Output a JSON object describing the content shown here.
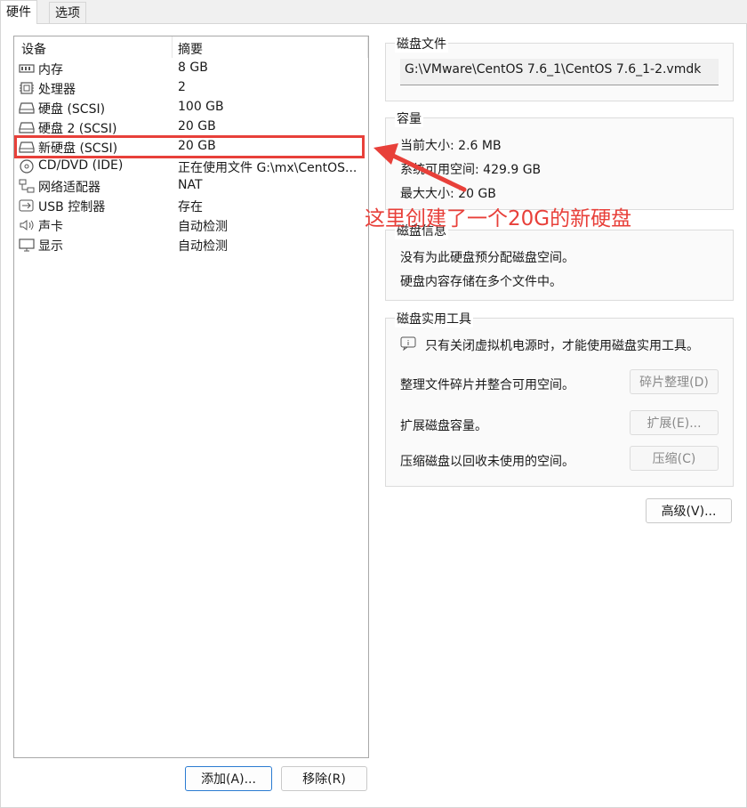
{
  "tabs": {
    "hardware": "硬件",
    "options": "选项"
  },
  "device_list": {
    "header": {
      "device": "设备",
      "summary": "摘要"
    },
    "rows": [
      {
        "icon": "memory-icon",
        "name": "内存",
        "summary": "8 GB"
      },
      {
        "icon": "processor-icon",
        "name": "处理器",
        "summary": "2"
      },
      {
        "icon": "hard-disk-icon",
        "name": "硬盘 (SCSI)",
        "summary": "100 GB"
      },
      {
        "icon": "hard-disk-icon",
        "name": "硬盘 2 (SCSI)",
        "summary": "20 GB"
      },
      {
        "icon": "hard-disk-icon",
        "name": "新硬盘 (SCSI)",
        "summary": "20 GB"
      },
      {
        "icon": "cd-dvd-icon",
        "name": "CD/DVD (IDE)",
        "summary": "正在使用文件 G:\\mx\\CentOS..."
      },
      {
        "icon": "network-adapter-icon",
        "name": "网络适配器",
        "summary": "NAT"
      },
      {
        "icon": "usb-icon",
        "name": "USB 控制器",
        "summary": "存在"
      },
      {
        "icon": "sound-card-icon",
        "name": "声卡",
        "summary": "自动检测"
      },
      {
        "icon": "display-icon",
        "name": "显示",
        "summary": "自动检测"
      }
    ],
    "selected_index": 4
  },
  "buttons": {
    "add": "添加(A)...",
    "remove": "移除(R)"
  },
  "disk_file": {
    "title": "磁盘文件",
    "path": "G:\\VMware\\CentOS 7.6_1\\CentOS 7.6_1-2.vmdk"
  },
  "capacity": {
    "title": "容量",
    "current_size": "当前大小: 2.6 MB",
    "system_free": "系统可用空间: 429.9 GB",
    "max_size": "最大大小: 20 GB"
  },
  "disk_info": {
    "title": "磁盘信息",
    "line1": "没有为此硬盘预分配磁盘空间。",
    "line2": "硬盘内容存储在多个文件中。"
  },
  "disk_utilities": {
    "title": "磁盘实用工具",
    "notice": "只有关闭虚拟机电源时，才能使用磁盘实用工具。",
    "defrag_text": "整理文件碎片并整合可用空间。",
    "defrag_btn": "碎片整理(D)",
    "expand_text": "扩展磁盘容量。",
    "expand_btn": "扩展(E)...",
    "compact_text": "压缩磁盘以回收未使用的空间。",
    "compact_btn": "压缩(C)"
  },
  "advanced_btn": "高级(V)...",
  "annotation": {
    "text": "这里创建了一个20G的新硬盘",
    "color": "#e8403a"
  }
}
